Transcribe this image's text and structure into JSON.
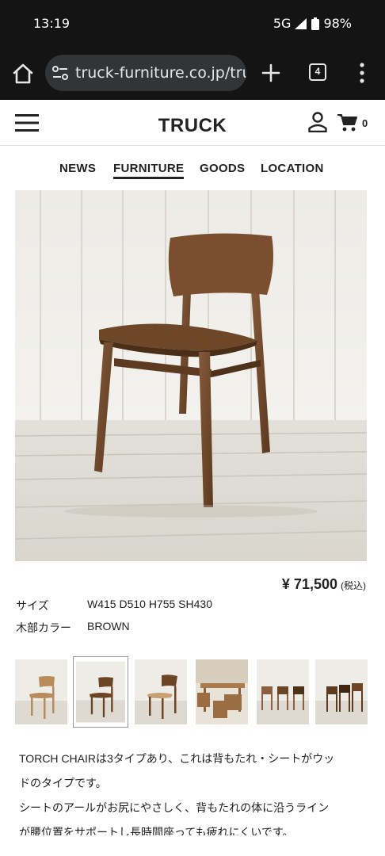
{
  "status": {
    "time": "13:19",
    "network": "5G",
    "battery": "98%"
  },
  "browser": {
    "url": "truck-furniture.co.jp/truc",
    "tab_count": "4"
  },
  "site": {
    "logo": "TRUCK",
    "cart_count": "0"
  },
  "nav": {
    "items": [
      "NEWS",
      "FURNITURE",
      "GOODS",
      "LOCATION"
    ],
    "active": "FURNITURE"
  },
  "product": {
    "price": "¥ 71,500",
    "tax_note": "(税込)",
    "specs": [
      {
        "label": "サイズ",
        "value": "W415 D510 H755 SH430"
      },
      {
        "label": "木部カラー",
        "value": "BROWN"
      }
    ],
    "description_lines": [
      "TORCH CHAIRは3タイプあり、これは背もたれ・シートがウッ",
      "ドのタイプです。",
      "シートのアールがお尻にやさしく、背もたれの体に沿うライン",
      "が腰位置をサポートし長時間座っても疲れにくいです。"
    ]
  },
  "colors": {
    "chrome": "#141414",
    "url_box": "#333436",
    "wood": "#6b4526"
  },
  "icons": [
    "home-icon",
    "site-settings-icon",
    "plus-icon",
    "tab-switcher-icon",
    "overflow-menu-icon",
    "hamburger-menu-icon",
    "user-icon",
    "cart-icon"
  ]
}
